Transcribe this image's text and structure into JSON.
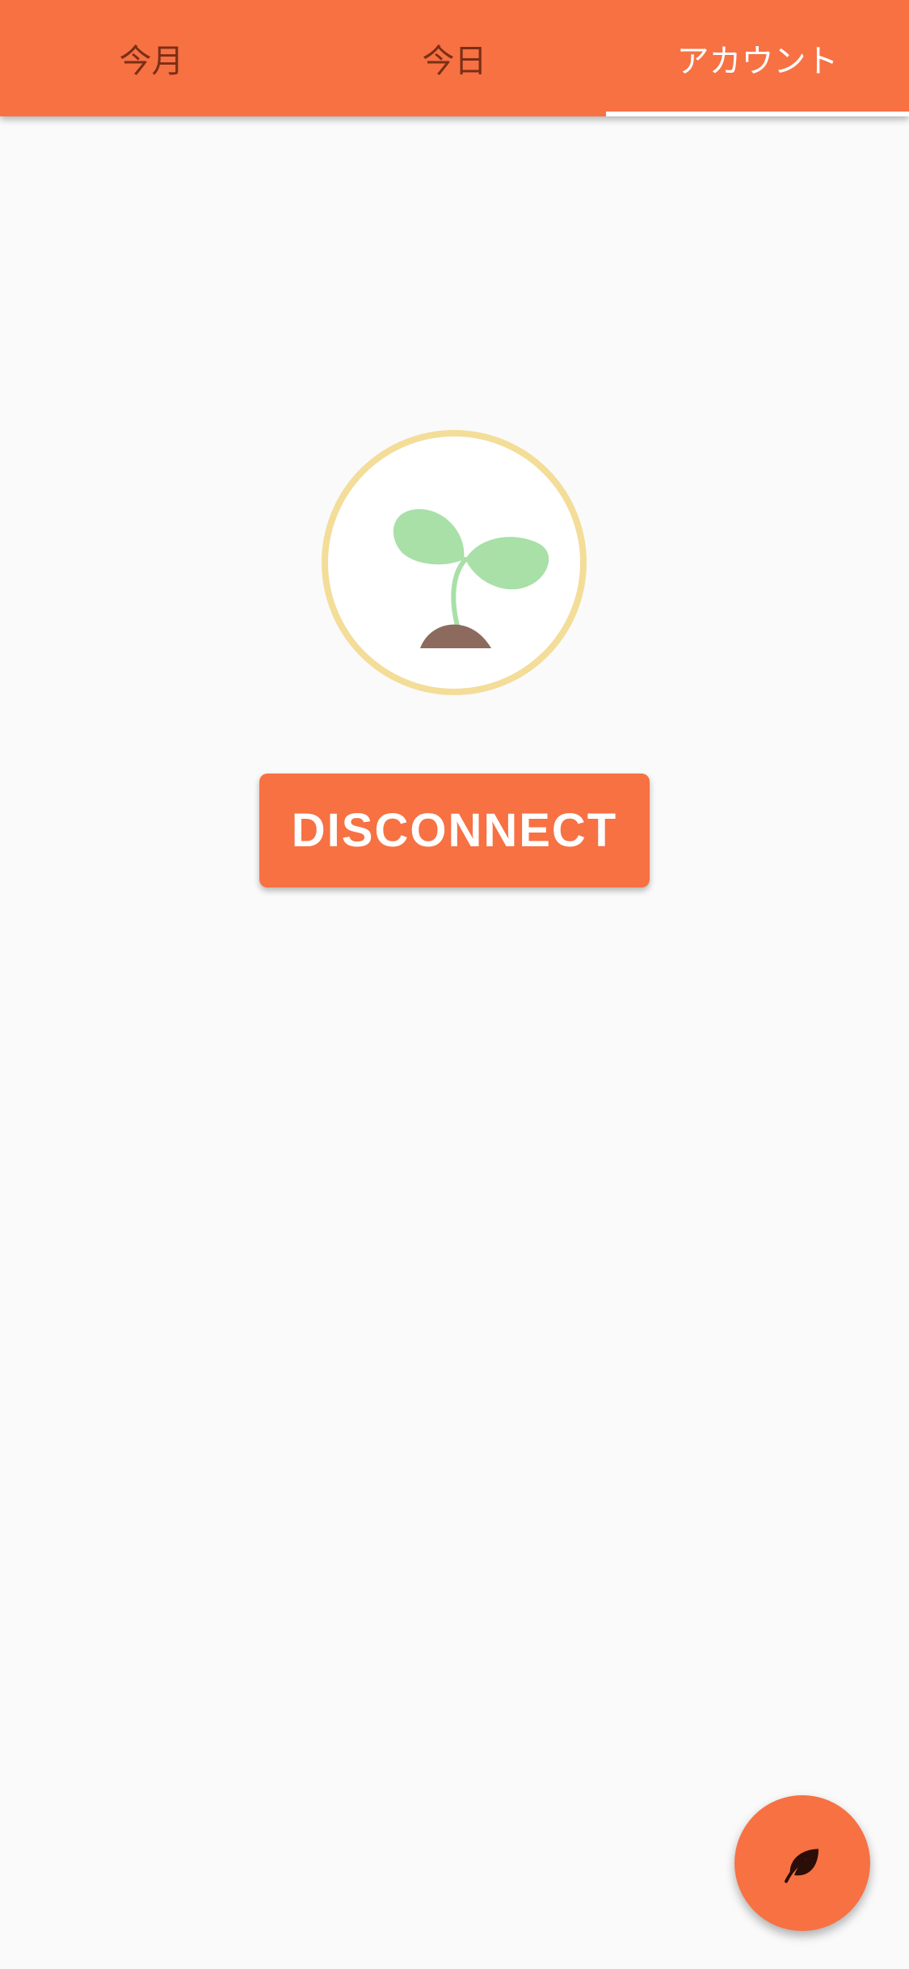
{
  "tabs": [
    {
      "label": "今月",
      "active": false
    },
    {
      "label": "今日",
      "active": false
    },
    {
      "label": "アカウント",
      "active": true
    }
  ],
  "avatar": {
    "icon": "sprout-icon"
  },
  "disconnect_button": {
    "label": "DISCONNECT"
  },
  "fab": {
    "icon": "leaf-icon"
  },
  "colors": {
    "accent": "#F77143",
    "background": "#FAFAFA",
    "avatar_border": "#F3DD98",
    "leaf_green": "#A8E0A8",
    "soil_brown": "#8C6B5E"
  }
}
